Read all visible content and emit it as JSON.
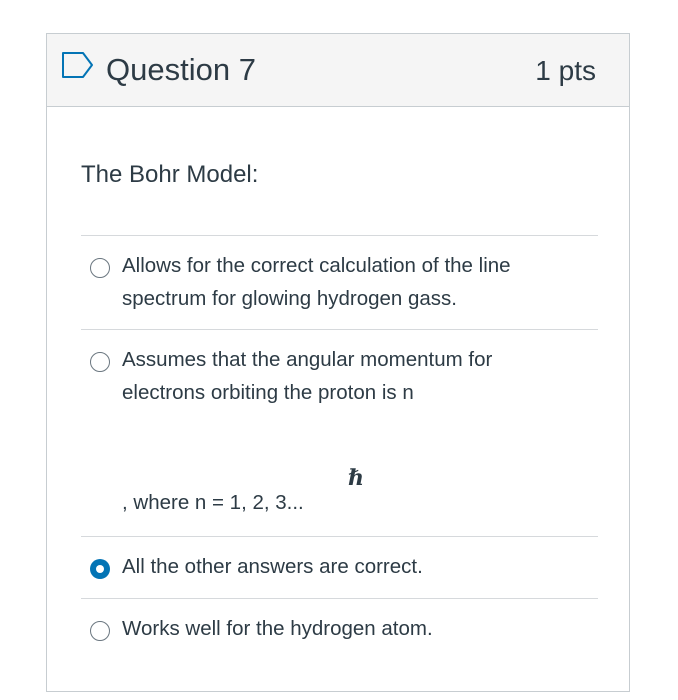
{
  "question": {
    "title": "Question 7",
    "points": "1 pts",
    "text": "The Bohr Model:"
  },
  "answers": [
    {
      "line1": "Allows for the correct calculation of the line",
      "line2": "spectrum for glowing hydrogen gass.",
      "selected": false
    },
    {
      "line1": "Assumes that the angular momentum for",
      "line2": "electrons orbiting the proton is n",
      "symbol": "ℏ",
      "line3": ", where n = 1, 2, 3...",
      "selected": false
    },
    {
      "line1": "All the other answers are correct.",
      "selected": true
    },
    {
      "line1": "Works well for the hydrogen atom.",
      "selected": false
    }
  ],
  "icons": {
    "flag": "bookmark-flag-icon"
  },
  "colors": {
    "accent": "#0374b5",
    "header_bg": "#f5f5f5",
    "text": "#2d3b45",
    "border": "#c7cdd1"
  }
}
